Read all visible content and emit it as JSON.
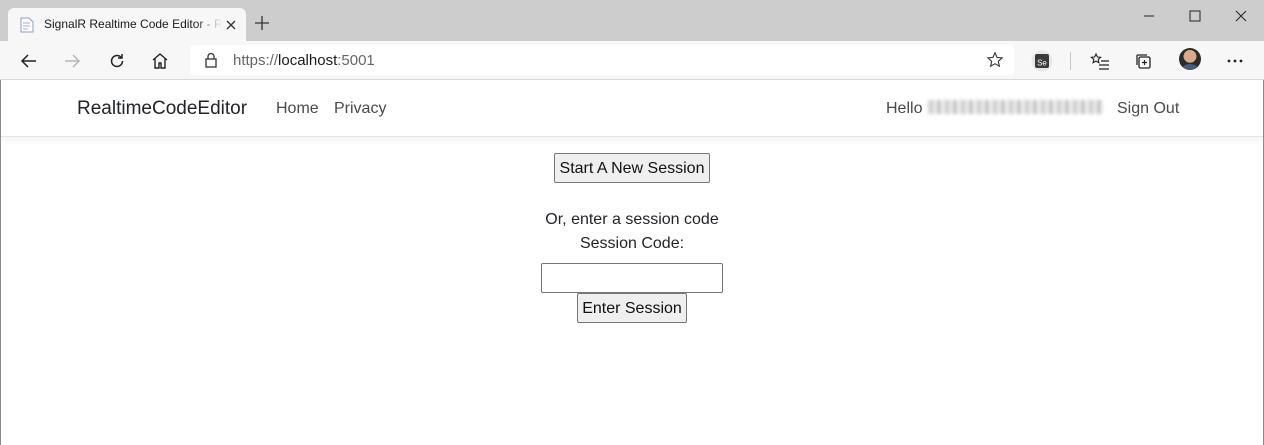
{
  "browser": {
    "tab": {
      "title": "SignalR Realtime Code Editor - RealtimeCodeEditor"
    },
    "address": {
      "protocol": "https://",
      "host": "localhost",
      "port": ":5001"
    },
    "extension_label": "Se"
  },
  "navbar": {
    "brand": "RealtimeCodeEditor",
    "links": {
      "home": "Home",
      "privacy": "Privacy"
    },
    "greeting": "Hello",
    "sign_out": "Sign Out"
  },
  "main": {
    "start_session_label": "Start A New Session",
    "or_text": "Or, enter a session code",
    "session_code_label": "Session Code:",
    "session_code_value": "",
    "enter_session_label": "Enter Session"
  }
}
